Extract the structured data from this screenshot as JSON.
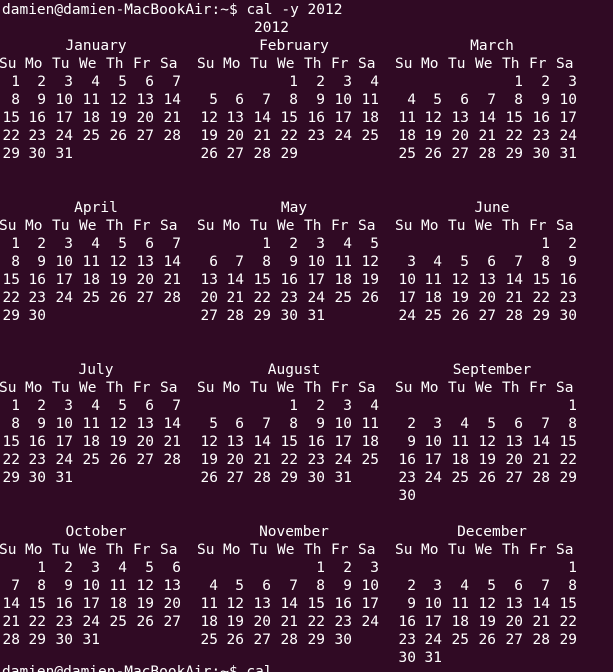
{
  "terminal": {
    "prompt": "damien@damien-MacBookAir:~$",
    "command": "cal -y 2012",
    "year_label": "2012",
    "next_line": "damien@damien-MacBookAir:~$ cal"
  },
  "weekdays": [
    "Su",
    "Mo",
    "Tu",
    "We",
    "Th",
    "Fr",
    "Sa"
  ],
  "months": [
    {
      "name": "January",
      "first_weekday": 0,
      "days": 31
    },
    {
      "name": "February",
      "first_weekday": 3,
      "days": 29
    },
    {
      "name": "March",
      "first_weekday": 4,
      "days": 31
    },
    {
      "name": "April",
      "first_weekday": 0,
      "days": 30
    },
    {
      "name": "May",
      "first_weekday": 2,
      "days": 31
    },
    {
      "name": "June",
      "first_weekday": 5,
      "days": 30
    },
    {
      "name": "July",
      "first_weekday": 0,
      "days": 31
    },
    {
      "name": "August",
      "first_weekday": 3,
      "days": 31
    },
    {
      "name": "September",
      "first_weekday": 6,
      "days": 30
    },
    {
      "name": "October",
      "first_weekday": 1,
      "days": 31
    },
    {
      "name": "November",
      "first_weekday": 4,
      "days": 30
    },
    {
      "name": "December",
      "first_weekday": 6,
      "days": 31
    }
  ],
  "colors": {
    "background": "#300a24",
    "foreground": "#ffffff"
  }
}
